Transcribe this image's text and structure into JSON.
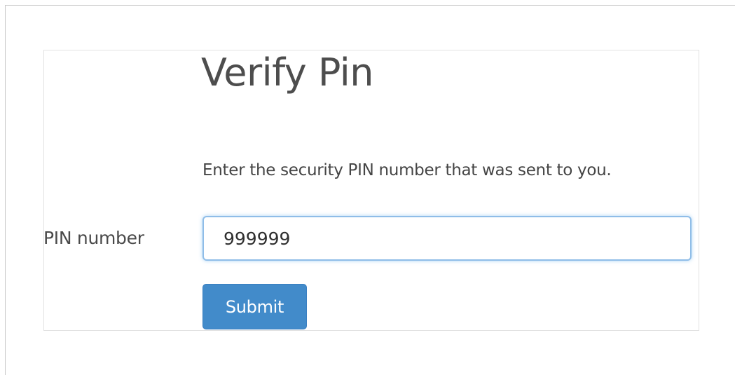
{
  "form": {
    "title": "Verify Pin",
    "instructions": "Enter the security PIN number that was sent to you.",
    "pin_label": "PIN number",
    "pin_value": "999999",
    "submit_label": "Submit"
  },
  "colors": {
    "primary_button": "#428bca",
    "input_focus_border": "#8fbde8",
    "text": "#4d4d4d"
  }
}
